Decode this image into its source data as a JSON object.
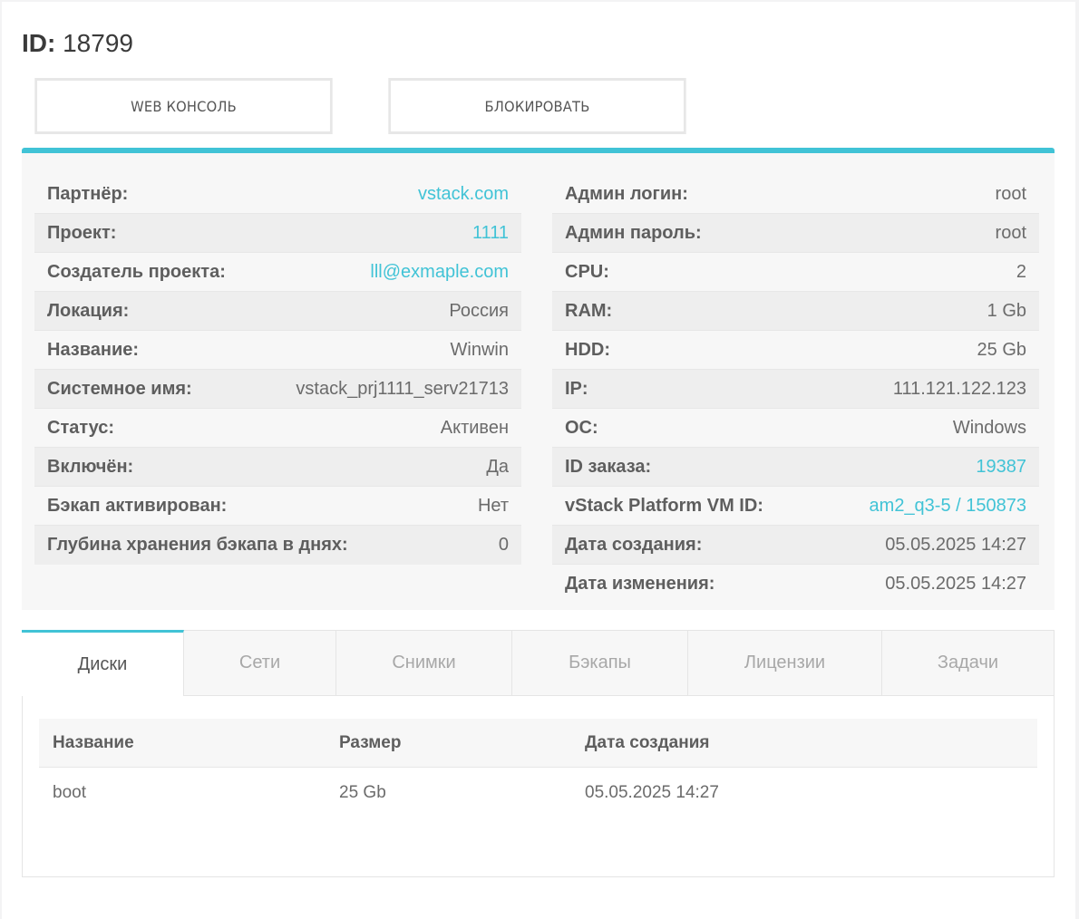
{
  "header": {
    "id_label": "ID:",
    "id_value": "18799"
  },
  "actions": {
    "console": "WEB КОНСОЛЬ",
    "block": "БЛОКИРОВАТЬ"
  },
  "info_left": [
    {
      "label": "Партнёр:",
      "value": "vstack.com",
      "link": true
    },
    {
      "label": "Проект:",
      "value": "1111",
      "link": true
    },
    {
      "label": "Создатель проекта:",
      "value": "lll@exmaple.com",
      "link": true
    },
    {
      "label": "Локация:",
      "value": "Россия",
      "link": false
    },
    {
      "label": "Название:",
      "value": "Winwin",
      "link": false
    },
    {
      "label": "Системное имя:",
      "value": "vstack_prj1111_serv21713",
      "link": false
    },
    {
      "label": "Статус:",
      "value": "Активен",
      "link": false
    },
    {
      "label": "Включён:",
      "value": "Да",
      "link": false
    },
    {
      "label": "Бэкап активирован:",
      "value": "Нет",
      "link": false
    },
    {
      "label": "Глубина хранения бэкапа в днях:",
      "value": "0",
      "link": false
    }
  ],
  "info_right": [
    {
      "label": "Админ логин:",
      "value": "root",
      "link": false
    },
    {
      "label": "Админ пароль:",
      "value": "root",
      "link": false
    },
    {
      "label": "CPU:",
      "value": "2",
      "link": false
    },
    {
      "label": "RAM:",
      "value": "1 Gb",
      "link": false
    },
    {
      "label": "HDD:",
      "value": "25 Gb",
      "link": false
    },
    {
      "label": "IP:",
      "value": "111.121.122.123",
      "link": false
    },
    {
      "label": "ОС:",
      "value": "Windows",
      "link": false
    },
    {
      "label": "ID заказа:",
      "value": "19387",
      "link": true
    },
    {
      "label": "vStack Platform VM ID:",
      "value": "am2_q3-5 / 150873",
      "link": true
    },
    {
      "label": "Дата создания:",
      "value": "05.05.2025 14:27",
      "link": false
    },
    {
      "label": "Дата изменения:",
      "value": "05.05.2025 14:27",
      "link": false
    }
  ],
  "tabs": [
    {
      "label": "Диски",
      "active": true
    },
    {
      "label": "Сети",
      "active": false
    },
    {
      "label": "Снимки",
      "active": false
    },
    {
      "label": "Бэкапы",
      "active": false
    },
    {
      "label": "Лицензии",
      "active": false
    },
    {
      "label": "Задачи",
      "active": false
    }
  ],
  "disks_table": {
    "columns": [
      "Название",
      "Размер",
      "Дата создания"
    ],
    "rows": [
      [
        "boot",
        "25 Gb",
        "05.05.2025 14:27"
      ]
    ]
  },
  "colors": {
    "accent": "#41c3d6",
    "text": "#676a6c"
  }
}
